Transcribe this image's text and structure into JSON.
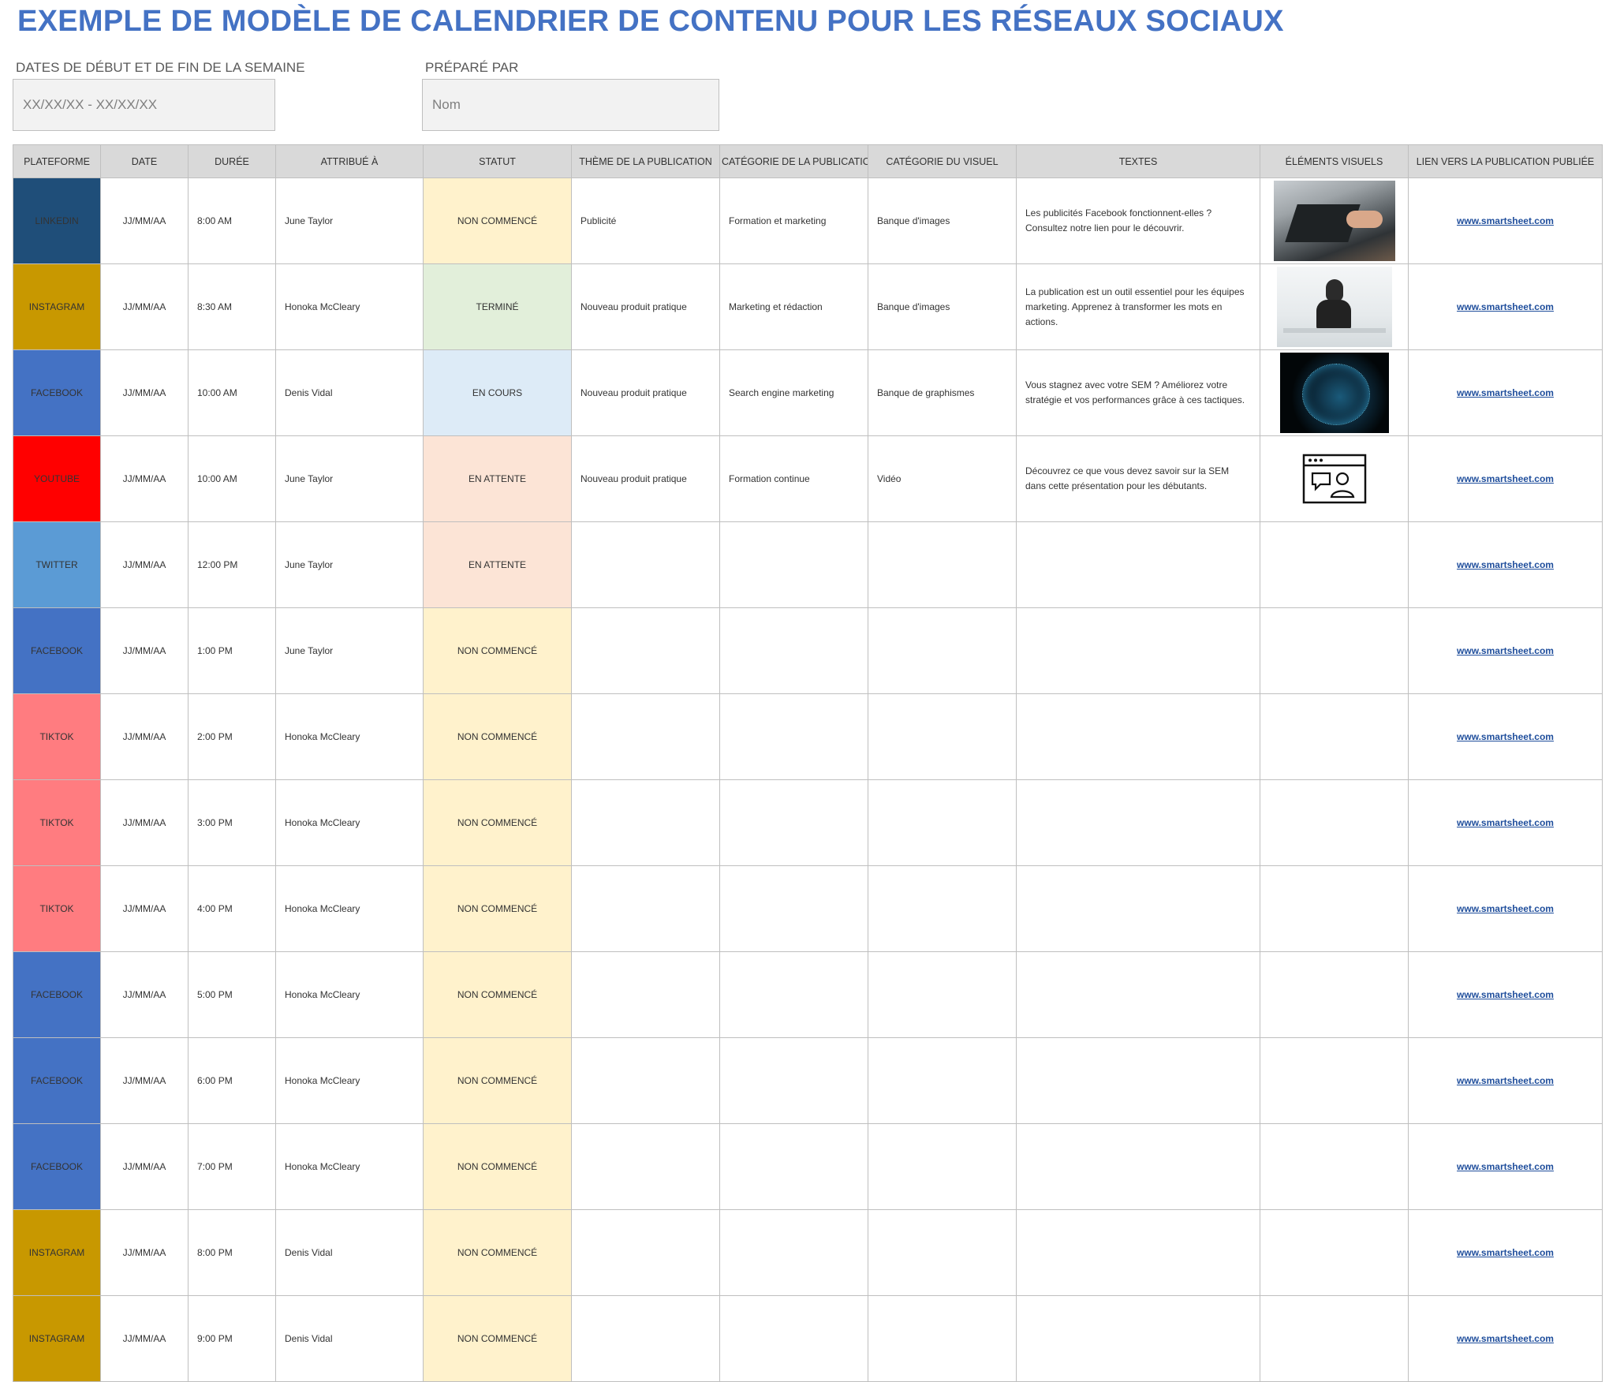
{
  "title": "EXEMPLE DE MODÈLE DE CALENDRIER DE CONTENU POUR LES RÉSEAUX SOCIAUX",
  "week_dates": {
    "label": "DATES DE DÉBUT ET DE FIN DE LA SEMAINE",
    "value": "XX/XX/XX - XX/XX/XX"
  },
  "prepared_by": {
    "label": "PRÉPARÉ PAR",
    "value": "Nom"
  },
  "columns": [
    "PLATEFORME",
    "DATE",
    "DURÉE",
    "ATTRIBUÉ À",
    "STATUT",
    "THÈME DE LA PUBLICATION",
    "CATÉGORIE DE LA PUBLICATION",
    "CATÉGORIE DU VISUEL",
    "TEXTES",
    "ÉLÉMENTS VISUELS",
    "LIEN VERS LA PUBLICATION PUBLIÉE"
  ],
  "colors": {
    "platforms": {
      "LINKEDIN": "#1f4e79",
      "INSTAGRAM": "#c89800",
      "FACEBOOK": "#4472c4",
      "YOUTUBE": "#ff0000",
      "TWITTER": "#5b9bd5",
      "TIKTOK": "#ff7c80"
    },
    "status": {
      "NON COMMENCÉ": "#fff2cc",
      "TERMINÉ": "#e2efda",
      "EN COURS": "#ddebf7",
      "EN ATTENTE": "#fce4d6"
    },
    "title": "#4472c4"
  },
  "rows": [
    {
      "platform": "LINKEDIN",
      "date": "JJ/MM/AA",
      "time": "8:00 AM",
      "assignee": "June Taylor",
      "status": "NON COMMENCÉ",
      "theme": "Publicité",
      "post_category": "Formation et marketing",
      "visual_category": "Banque d'images",
      "text": "Les publicités Facebook fonctionnent-elles ? Consultez notre lien pour le découvrir.",
      "visual": "laptop-photo",
      "link": "www.smartsheet.com"
    },
    {
      "platform": "INSTAGRAM",
      "date": "JJ/MM/AA",
      "time": "8:30 AM",
      "assignee": "Honoka McCleary",
      "status": "TERMINÉ",
      "theme": "Nouveau produit pratique",
      "post_category": "Marketing et rédaction",
      "visual_category": "Banque d'images",
      "text": "La publication est un outil essentiel pour les équipes marketing. Apprenez à transformer les mots en actions.",
      "visual": "woman-at-desk-photo",
      "link": "www.smartsheet.com"
    },
    {
      "platform": "FACEBOOK",
      "date": "JJ/MM/AA",
      "time": "10:00 AM",
      "assignee": "Denis Vidal",
      "status": "EN COURS",
      "theme": "Nouveau produit pratique",
      "post_category": "Search engine marketing",
      "visual_category": "Banque de graphismes",
      "text": "Vous stagnez avec votre SEM ? Améliorez votre stratégie et vos performances grâce à ces tactiques.",
      "visual": "network-globe-graphic",
      "link": "www.smartsheet.com"
    },
    {
      "platform": "YOUTUBE",
      "date": "JJ/MM/AA",
      "time": "10:00 AM",
      "assignee": "June Taylor",
      "status": "EN ATTENTE",
      "theme": "Nouveau produit pratique",
      "post_category": "Formation continue",
      "visual_category": "Vidéo",
      "text": "Découvrez ce que vous devez savoir sur la SEM dans cette présentation pour les débutants.",
      "visual": "webinar-icon",
      "link": "www.smartsheet.com"
    },
    {
      "platform": "TWITTER",
      "date": "JJ/MM/AA",
      "time": "12:00 PM",
      "assignee": "June Taylor",
      "status": "EN ATTENTE",
      "theme": "",
      "post_category": "",
      "visual_category": "",
      "text": "",
      "visual": "",
      "link": "www.smartsheet.com"
    },
    {
      "platform": "FACEBOOK",
      "date": "JJ/MM/AA",
      "time": "1:00 PM",
      "assignee": "June Taylor",
      "status": "NON COMMENCÉ",
      "theme": "",
      "post_category": "",
      "visual_category": "",
      "text": "",
      "visual": "",
      "link": "www.smartsheet.com"
    },
    {
      "platform": "TIKTOK",
      "date": "JJ/MM/AA",
      "time": "2:00 PM",
      "assignee": "Honoka McCleary",
      "status": "NON COMMENCÉ",
      "theme": "",
      "post_category": "",
      "visual_category": "",
      "text": "",
      "visual": "",
      "link": "www.smartsheet.com"
    },
    {
      "platform": "TIKTOK",
      "date": "JJ/MM/AA",
      "time": "3:00 PM",
      "assignee": "Honoka McCleary",
      "status": "NON COMMENCÉ",
      "theme": "",
      "post_category": "",
      "visual_category": "",
      "text": "",
      "visual": "",
      "link": "www.smartsheet.com"
    },
    {
      "platform": "TIKTOK",
      "date": "JJ/MM/AA",
      "time": "4:00 PM",
      "assignee": "Honoka McCleary",
      "status": "NON COMMENCÉ",
      "theme": "",
      "post_category": "",
      "visual_category": "",
      "text": "",
      "visual": "",
      "link": "www.smartsheet.com"
    },
    {
      "platform": "FACEBOOK",
      "date": "JJ/MM/AA",
      "time": "5:00 PM",
      "assignee": "Honoka McCleary",
      "status": "NON COMMENCÉ",
      "theme": "",
      "post_category": "",
      "visual_category": "",
      "text": "",
      "visual": "",
      "link": "www.smartsheet.com"
    },
    {
      "platform": "FACEBOOK",
      "date": "JJ/MM/AA",
      "time": "6:00 PM",
      "assignee": "Honoka McCleary",
      "status": "NON COMMENCÉ",
      "theme": "",
      "post_category": "",
      "visual_category": "",
      "text": "",
      "visual": "",
      "link": "www.smartsheet.com"
    },
    {
      "platform": "FACEBOOK",
      "date": "JJ/MM/AA",
      "time": "7:00 PM",
      "assignee": "Honoka McCleary",
      "status": "NON COMMENCÉ",
      "theme": "",
      "post_category": "",
      "visual_category": "",
      "text": "",
      "visual": "",
      "link": "www.smartsheet.com"
    },
    {
      "platform": "INSTAGRAM",
      "date": "JJ/MM/AA",
      "time": "8:00 PM",
      "assignee": "Denis Vidal",
      "status": "NON COMMENCÉ",
      "theme": "",
      "post_category": "",
      "visual_category": "",
      "text": "",
      "visual": "",
      "link": "www.smartsheet.com"
    },
    {
      "platform": "INSTAGRAM",
      "date": "JJ/MM/AA",
      "time": "9:00 PM",
      "assignee": "Denis Vidal",
      "status": "NON COMMENCÉ",
      "theme": "",
      "post_category": "",
      "visual_category": "",
      "text": "",
      "visual": "",
      "link": "www.smartsheet.com"
    }
  ]
}
